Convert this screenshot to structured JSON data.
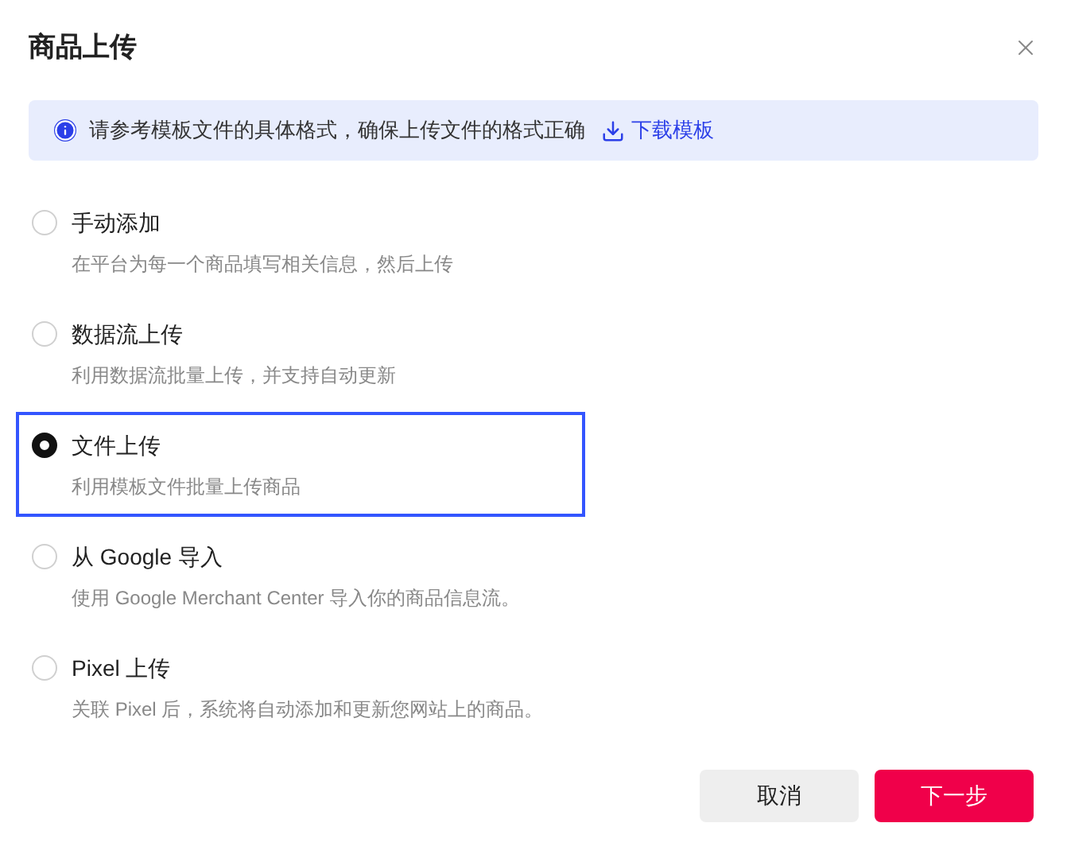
{
  "dialog": {
    "title": "商品上传"
  },
  "notice": {
    "text": "请参考模板文件的具体格式，确保上传文件的格式正确",
    "link": "下载模板"
  },
  "options": [
    {
      "label": "手动添加",
      "description": "在平台为每一个商品填写相关信息，然后上传",
      "selected": false
    },
    {
      "label": "数据流上传",
      "description": "利用数据流批量上传，并支持自动更新",
      "selected": false
    },
    {
      "label": "文件上传",
      "description": "利用模板文件批量上传商品",
      "selected": true
    },
    {
      "label": "从 Google 导入",
      "description": "使用 Google Merchant Center 导入你的商品信息流。",
      "selected": false
    },
    {
      "label": "Pixel 上传",
      "description": "关联 Pixel 后，系统将自动添加和更新您网站上的商品。",
      "selected": false
    }
  ],
  "buttons": [
    {
      "label": "取消",
      "kind": "secondary"
    },
    {
      "label": "下一步",
      "kind": "primary"
    }
  ]
}
